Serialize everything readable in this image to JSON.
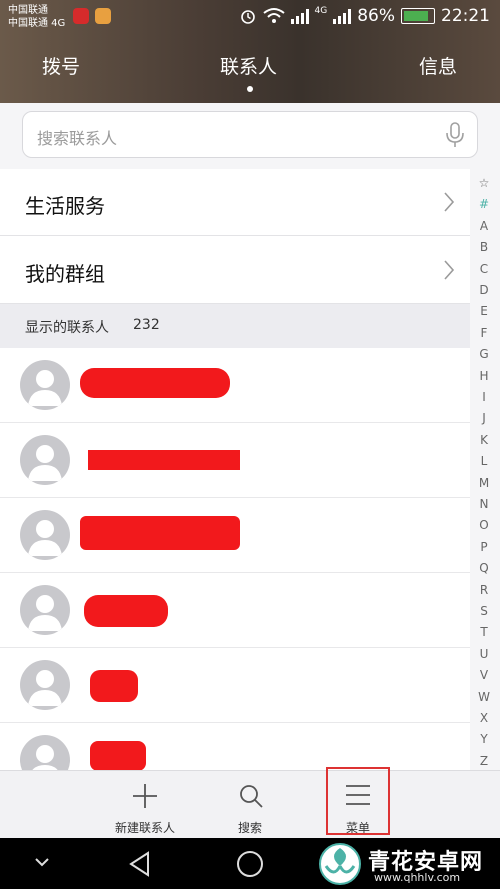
{
  "status_bar": {
    "carrier1": "中国联通",
    "carrier2": "中国联通 4G",
    "net_label": "4G",
    "battery": "86%",
    "battery_level": 0.86,
    "time": "22:21"
  },
  "tabs": [
    "拨号",
    "联系人",
    "信息"
  ],
  "active_tab": 1,
  "search": {
    "placeholder": "搜索联系人"
  },
  "menu_rows": [
    {
      "label": "生活服务"
    },
    {
      "label": "我的群组"
    }
  ],
  "section": {
    "title": "显示的联系人",
    "count": "232"
  },
  "contacts_visible": 6,
  "alpha_index": [
    "☆",
    "#",
    "A",
    "B",
    "C",
    "D",
    "E",
    "F",
    "G",
    "H",
    "I",
    "J",
    "K",
    "L",
    "M",
    "N",
    "O",
    "P",
    "Q",
    "R",
    "S",
    "T",
    "U",
    "V",
    "W",
    "X",
    "Y",
    "Z"
  ],
  "bottom_bar": [
    {
      "label": "新建联系人",
      "icon": "plus-icon"
    },
    {
      "label": "搜索",
      "icon": "search-icon"
    },
    {
      "label": "菜单",
      "icon": "menu-icon"
    }
  ],
  "watermark": {
    "title": "青花安卓网",
    "url": "www.qhhlv.com"
  },
  "colors": {
    "accent": "#4cb2a7",
    "redaction": "#f2191c",
    "highlight": "#d33333"
  }
}
